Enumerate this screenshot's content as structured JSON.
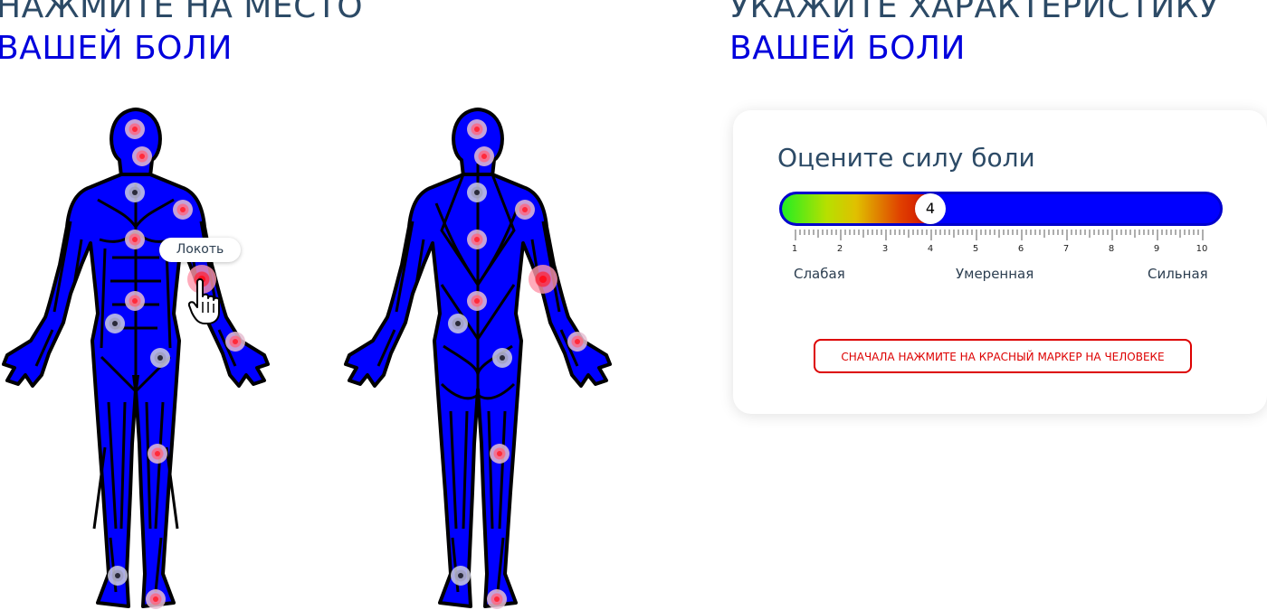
{
  "left_heading": {
    "line1": "НАЖМИТЕ НА МЕСТО",
    "line2": "ВАШЕЙ БОЛИ"
  },
  "right_heading": {
    "line1": "УКАЖИТЕ ХАРАКТЕРИСТИКУ",
    "line2": "ВАШЕЙ БОЛИ"
  },
  "tooltip": {
    "label": "Локоть"
  },
  "pain_card": {
    "title": "Оцените силу боли",
    "slider": {
      "value": 4,
      "min": 1,
      "max": 10
    },
    "tick_labels": [
      "1",
      "2",
      "3",
      "4",
      "5",
      "6",
      "7",
      "8",
      "9",
      "10"
    ],
    "range_labels": {
      "low": "Слабая",
      "mid": "Умеренная",
      "high": "Сильная"
    },
    "cta_label": "СНАЧАЛА НАЖМИТЕ НА КРАСНЫЙ МАРКЕР НА ЧЕЛОВЕКЕ"
  },
  "colors": {
    "body_blue": "#0000ff",
    "heading_dark": "#2c4a66",
    "heading_blue": "#0000dd",
    "alert_red": "#dd0000"
  },
  "markers_front": [
    {
      "type": "red"
    },
    {
      "type": "red"
    },
    {
      "type": "gray"
    },
    {
      "type": "red"
    },
    {
      "type": "red"
    },
    {
      "type": "red",
      "active": true
    },
    {
      "type": "red"
    },
    {
      "type": "gray"
    },
    {
      "type": "red"
    },
    {
      "type": "gray"
    },
    {
      "type": "red"
    },
    {
      "type": "gray"
    },
    {
      "type": "red"
    }
  ],
  "markers_back": [
    {
      "type": "red"
    },
    {
      "type": "red"
    },
    {
      "type": "gray"
    },
    {
      "type": "red"
    },
    {
      "type": "red"
    },
    {
      "type": "red",
      "active": true
    },
    {
      "type": "red"
    },
    {
      "type": "gray"
    },
    {
      "type": "red"
    },
    {
      "type": "gray"
    },
    {
      "type": "red"
    },
    {
      "type": "gray"
    },
    {
      "type": "red"
    }
  ]
}
